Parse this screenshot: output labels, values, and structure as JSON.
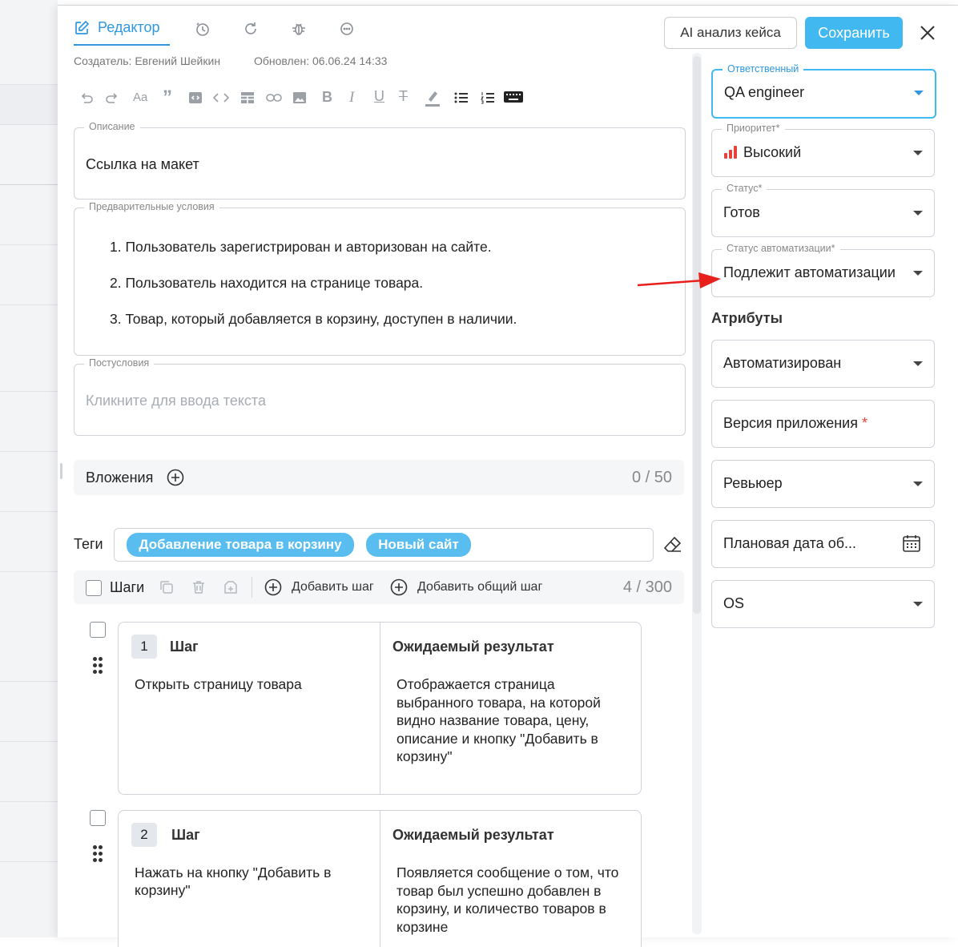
{
  "tabs": {
    "editor": "Редактор"
  },
  "header": {
    "ai_button": "AI анализ кейса",
    "save_button": "Сохранить"
  },
  "meta": {
    "creator": "Создатель: Евгений Шейкин",
    "updated": "Обновлен: 06.06.24 14:33"
  },
  "description": {
    "legend": "Описание",
    "text": "Ссылка на макет"
  },
  "preconditions": {
    "legend": "Предварительные условия",
    "items": [
      "1. Пользователь зарегистрирован и авторизован на сайте.",
      "2. Пользователь находится на странице товара.",
      "3. Товар, который добавляется в корзину, доступен в наличии."
    ]
  },
  "postconditions": {
    "legend": "Постусловия",
    "placeholder": "Кликните для ввода текста"
  },
  "attachments": {
    "label": "Вложения",
    "count": "0 / 50"
  },
  "tags": {
    "label": "Теги",
    "items": [
      "Добавление товара в корзину",
      "Новый сайт"
    ]
  },
  "steps_bar": {
    "label": "Шаги",
    "add_step": "Добавить шаг",
    "add_common_step": "Добавить общий шаг",
    "count": "4 / 300"
  },
  "steps": [
    {
      "num": "1",
      "step_header": "Шаг",
      "result_header": "Ожидаемый результат",
      "action": "Открыть страницу товара",
      "result": "Отображается страница выбранного товара, на которой видно название товара, цену, описание и кнопку \"Добавить в корзину\""
    },
    {
      "num": "2",
      "step_header": "Шаг",
      "result_header": "Ожидаемый результат",
      "action": "Нажать на кнопку \"Добавить в корзину\"",
      "result": "Появляется сообщение о том, что товар был успешно добавлен в корзину, и количество товаров в корзине"
    }
  ],
  "sidebar": {
    "responsible": {
      "legend": "Ответственный",
      "value": "QA engineer"
    },
    "priority": {
      "legend": "Приоритет*",
      "value": "Высокий"
    },
    "status": {
      "legend": "Статус*",
      "value": "Готов"
    },
    "automation_status": {
      "legend": "Статус автоматизации*",
      "value": "Подлежит автоматизации"
    },
    "attributes_title": "Атрибуты",
    "automated": "Автоматизирован",
    "app_version": "Версия приложения",
    "required_star": "*",
    "reviewer": "Ревьюер",
    "planned_date": "Плановая дата об...",
    "os": "OS"
  },
  "colors": {
    "accent": "#2f98e0",
    "primary_button": "#41b8ef",
    "tag_chip": "#59bdf0",
    "annotation_arrow": "#e8201c",
    "priority_bars": "#e8403a"
  }
}
